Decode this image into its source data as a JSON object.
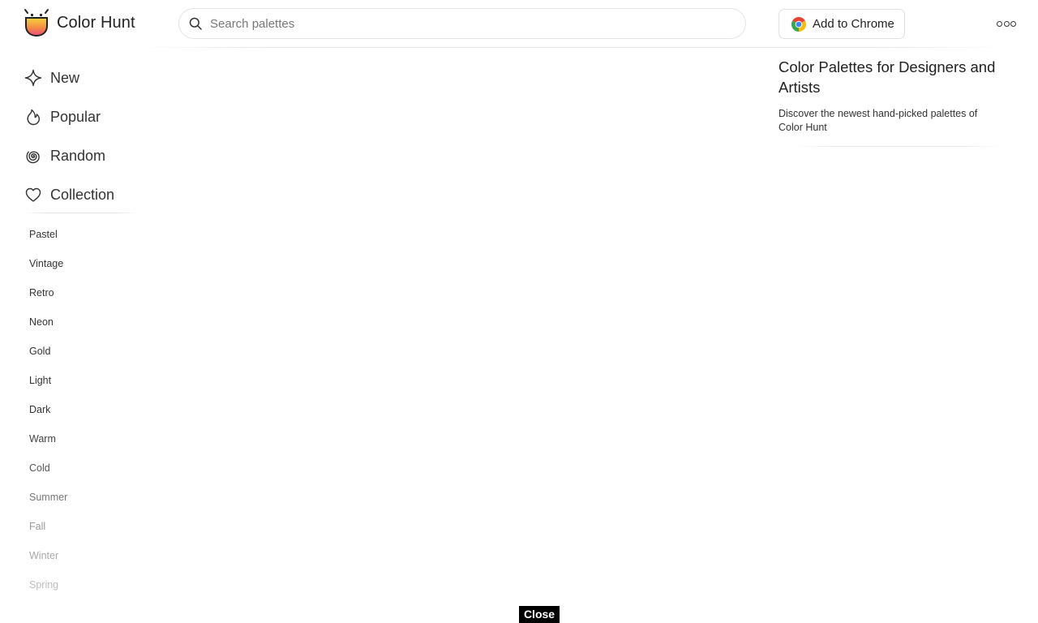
{
  "header": {
    "logo_text": "Color Hunt",
    "logo_icon": "color-hunt-logo-icon",
    "search": {
      "placeholder": "Search palettes",
      "value": ""
    },
    "add_to_chrome_label": "Add to Chrome",
    "chrome_icon": "chrome-icon",
    "more_icon": "more-options-icon"
  },
  "nav": {
    "items": [
      {
        "label": "New",
        "icon": "sparkle-icon"
      },
      {
        "label": "Popular",
        "icon": "flame-icon"
      },
      {
        "label": "Random",
        "icon": "spiral-icon"
      },
      {
        "label": "Collection",
        "icon": "heart-icon"
      }
    ]
  },
  "tags": [
    {
      "label": "Pastel",
      "color": "#333333"
    },
    {
      "label": "Vintage",
      "color": "#333333"
    },
    {
      "label": "Retro",
      "color": "#333333"
    },
    {
      "label": "Neon",
      "color": "#333333"
    },
    {
      "label": "Gold",
      "color": "#333333"
    },
    {
      "label": "Light",
      "color": "#333333"
    },
    {
      "label": "Dark",
      "color": "#333333"
    },
    {
      "label": "Warm",
      "color": "#444444"
    },
    {
      "label": "Cold",
      "color": "#555555"
    },
    {
      "label": "Summer",
      "color": "#777777"
    },
    {
      "label": "Fall",
      "color": "#999999"
    },
    {
      "label": "Winter",
      "color": "#a8a8a8"
    },
    {
      "label": "Spring",
      "color": "#bdbdbd"
    }
  ],
  "info": {
    "title": "Color Palettes for Designers and Artists",
    "description": "Discover the newest hand-picked palettes of Color Hunt"
  },
  "close_label": "Close",
  "colors": {
    "logo_gradient_top": "#f5d63b",
    "logo_gradient_mid": "#f58b43",
    "logo_gradient_bottom": "#ea4c7b",
    "logo_outline": "#222222"
  }
}
